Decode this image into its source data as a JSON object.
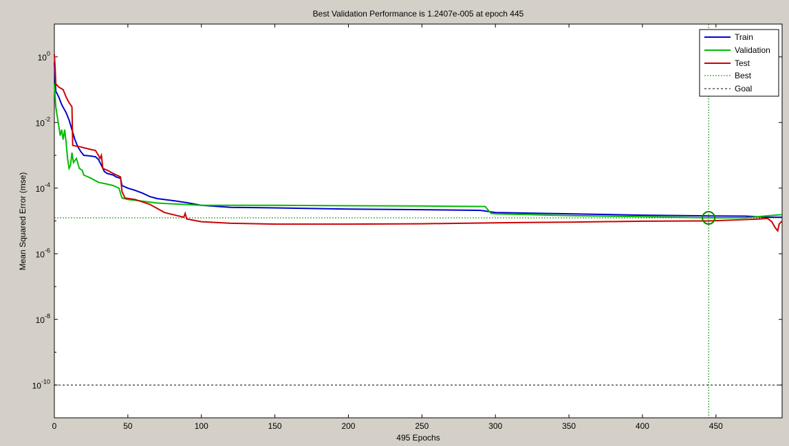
{
  "chart_data": {
    "type": "line",
    "title": "Best Validation Performance is 1.2407e-005 at epoch 445",
    "xlabel": "495 Epochs",
    "ylabel": "Mean Squared Error  (mse)",
    "xlim": [
      0,
      495
    ],
    "ylim_log10": [
      -11,
      1
    ],
    "yscale": "log",
    "x_ticks": [
      0,
      50,
      100,
      150,
      200,
      250,
      300,
      350,
      400,
      450
    ],
    "y_tick_exponents": [
      0,
      -2,
      -4,
      -6,
      -8,
      -10
    ],
    "y_tick_base": "10",
    "grid": false,
    "legend_position": "top-right",
    "legend": [
      "Train",
      "Validation",
      "Test",
      "Best",
      "Goal"
    ],
    "best": {
      "epoch": 445,
      "value": 1.2407e-05
    },
    "goal": 1e-10,
    "colors": {
      "train": "#0000cc",
      "validation": "#00bb00",
      "test": "#cc0000",
      "best": "#008800",
      "goal": "#000000",
      "background": "#d4d0c8",
      "axes": "#ffffff"
    },
    "series": [
      {
        "name": "Train",
        "style": "solid",
        "points": [
          [
            0,
            0.7
          ],
          [
            1,
            0.09
          ],
          [
            3,
            0.06
          ],
          [
            5,
            0.035
          ],
          [
            8,
            0.02
          ],
          [
            10,
            0.012
          ],
          [
            12,
            0.006
          ],
          [
            14,
            0.003
          ],
          [
            16,
            0.0018
          ],
          [
            18,
            0.0013
          ],
          [
            20,
            0.001
          ],
          [
            25,
            0.00095
          ],
          [
            28,
            0.0009
          ],
          [
            30,
            0.00075
          ],
          [
            32,
            0.0005
          ],
          [
            34,
            0.00032
          ],
          [
            36,
            0.00028
          ],
          [
            40,
            0.00025
          ],
          [
            42,
            0.00022
          ],
          [
            45,
            0.0002
          ],
          [
            46,
            0.00012
          ],
          [
            50,
            0.0001
          ],
          [
            55,
            8.5e-05
          ],
          [
            60,
            7e-05
          ],
          [
            65,
            5.5e-05
          ],
          [
            70,
            4.8e-05
          ],
          [
            80,
            4.2e-05
          ],
          [
            90,
            3.6e-05
          ],
          [
            100,
            3e-05
          ],
          [
            120,
            2.6e-05
          ],
          [
            150,
            2.5e-05
          ],
          [
            200,
            2.3e-05
          ],
          [
            250,
            2.2e-05
          ],
          [
            290,
            2.1e-05
          ],
          [
            300,
            1.8e-05
          ],
          [
            350,
            1.65e-05
          ],
          [
            400,
            1.5e-05
          ],
          [
            445,
            1.42e-05
          ],
          [
            470,
            1.4e-05
          ],
          [
            485,
            1.3e-05
          ],
          [
            495,
            1.3e-05
          ]
        ]
      },
      {
        "name": "Validation",
        "style": "solid",
        "points": [
          [
            0,
            0.15
          ],
          [
            1,
            0.03
          ],
          [
            2,
            0.015
          ],
          [
            3,
            0.008
          ],
          [
            4,
            0.004
          ],
          [
            5,
            0.006
          ],
          [
            6,
            0.003
          ],
          [
            7,
            0.006
          ],
          [
            8,
            0.0025
          ],
          [
            9,
            0.0008
          ],
          [
            10,
            0.0004
          ],
          [
            11,
            0.0005
          ],
          [
            12,
            0.0012
          ],
          [
            13,
            0.0006
          ],
          [
            15,
            0.0008
          ],
          [
            17,
            0.0004
          ],
          [
            19,
            0.00035
          ],
          [
            20,
            0.00025
          ],
          [
            25,
            0.0002
          ],
          [
            30,
            0.00015
          ],
          [
            35,
            0.000135
          ],
          [
            40,
            0.00012
          ],
          [
            44,
            0.0001
          ],
          [
            46,
            5e-05
          ],
          [
            50,
            4.5e-05
          ],
          [
            60,
            4e-05
          ],
          [
            70,
            3.5e-05
          ],
          [
            100,
            3e-05
          ],
          [
            150,
            3e-05
          ],
          [
            200,
            2.9e-05
          ],
          [
            250,
            2.85e-05
          ],
          [
            293,
            2.75e-05
          ],
          [
            297,
            1.7e-05
          ],
          [
            300,
            1.65e-05
          ],
          [
            350,
            1.45e-05
          ],
          [
            400,
            1.35e-05
          ],
          [
            445,
            1.24e-05
          ],
          [
            470,
            1.25e-05
          ],
          [
            490,
            1.5e-05
          ],
          [
            495,
            1.55e-05
          ]
        ]
      },
      {
        "name": "Test",
        "style": "solid",
        "points": [
          [
            0,
            1.2
          ],
          [
            0.5,
            0.5
          ],
          [
            1,
            0.15
          ],
          [
            3,
            0.12
          ],
          [
            6,
            0.1
          ],
          [
            8,
            0.06
          ],
          [
            10,
            0.04
          ],
          [
            11,
            0.035
          ],
          [
            12,
            0.03
          ],
          [
            12.5,
            0.002
          ],
          [
            15,
            0.0019
          ],
          [
            18,
            0.0018
          ],
          [
            20,
            0.0017
          ],
          [
            25,
            0.0015
          ],
          [
            28,
            0.0014
          ],
          [
            30,
            0.001
          ],
          [
            31,
            0.0008
          ],
          [
            32,
            0.001
          ],
          [
            33,
            0.0004
          ],
          [
            36,
            0.00035
          ],
          [
            40,
            0.00028
          ],
          [
            45,
            0.00022
          ],
          [
            46,
            8e-05
          ],
          [
            48,
            5e-05
          ],
          [
            55,
            4.5e-05
          ],
          [
            65,
            3.2e-05
          ],
          [
            75,
            1.8e-05
          ],
          [
            88,
            1.3e-05
          ],
          [
            89,
            1.7e-05
          ],
          [
            90,
            1.15e-05
          ],
          [
            100,
            9.5e-06
          ],
          [
            120,
            8.5e-06
          ],
          [
            150,
            8e-06
          ],
          [
            200,
            8e-06
          ],
          [
            250,
            8.2e-06
          ],
          [
            300,
            8.8e-06
          ],
          [
            350,
            9.2e-06
          ],
          [
            400,
            9.8e-06
          ],
          [
            445,
            1e-05
          ],
          [
            470,
            1.1e-05
          ],
          [
            480,
            1.15e-05
          ],
          [
            485,
            1.2e-05
          ],
          [
            488,
            9.5e-06
          ],
          [
            490,
            6.5e-06
          ],
          [
            492,
            5e-06
          ],
          [
            493,
            8e-06
          ],
          [
            495,
            1e-05
          ]
        ]
      }
    ]
  }
}
